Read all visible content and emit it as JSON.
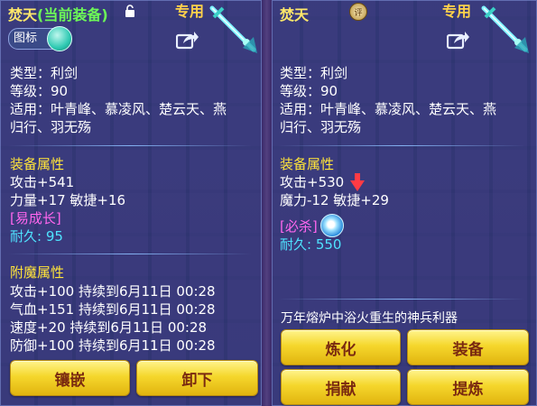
{
  "left": {
    "name": "焚天",
    "equip_status": "(当前装备)",
    "exclusive_label": "专用",
    "toggle_label": "图标",
    "type_line": "类型：利剑",
    "level_line": "等级：90",
    "applicable_line1": "适用：叶青峰、慕凌风、楚云天、燕",
    "applicable_line2": "归行、羽无殇",
    "attr_title": "装备属性",
    "attr_line1": "攻击+541",
    "attr_line2": "力量+17 敏捷+16",
    "special_tag": "[易成长]",
    "durability_label": "耐久:",
    "durability_value": "95",
    "enchant_title": "附魔属性",
    "enchant": [
      "攻击+100 持续到6月11日 00:28",
      "气血+151 持续到6月11日 00:28",
      "速度+20 持续到6月11日 00:28",
      "防御+100 持续到6月11日 00:28"
    ],
    "buttons": {
      "inlay": "镶嵌",
      "unequip": "卸下"
    }
  },
  "right": {
    "name": "焚天",
    "exclusive_label": "专用",
    "badge_text": "评",
    "type_line": "类型：利剑",
    "level_line": "等级：90",
    "applicable_line1": "适用：叶青峰、慕凌风、楚云天、燕",
    "applicable_line2": "归行、羽无殇",
    "attr_title": "装备属性",
    "attr_line1": "攻击+530",
    "attr_line2": "魔力-12 敏捷+29",
    "special_tag": "[必杀]",
    "durability_label": "耐久:",
    "durability_value": "550",
    "description": "万年熔炉中浴火重生的神兵利器",
    "buttons": {
      "refine": "炼化",
      "equip": "装备",
      "donate": "捐献",
      "extract": "提炼"
    }
  },
  "colors": {
    "panel": "#3a488c",
    "name_yellow": "#ffe86a",
    "equip_green": "#6dfb57",
    "section_yellow": "#ffe43a",
    "tag_pink": "#ff66ee",
    "durability_cyan": "#4fe3ff",
    "button_gold": "#f5d72c",
    "button_text": "#7a2a10"
  },
  "icons": [
    "lock-icon",
    "share-icon",
    "sword-icon",
    "toggle-orb",
    "rating-badge",
    "skill-orb-icon",
    "down-arrow-icon"
  ]
}
